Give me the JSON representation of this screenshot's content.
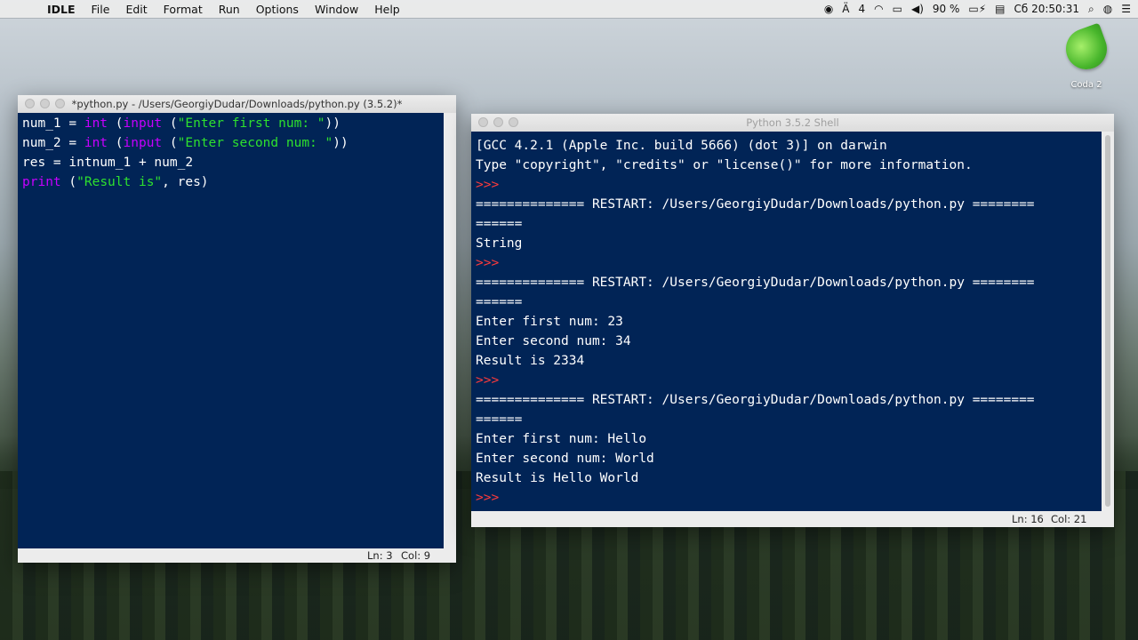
{
  "menubar": {
    "app_name": "IDLE",
    "items": [
      "File",
      "Edit",
      "Format",
      "Run",
      "Options",
      "Window",
      "Help"
    ],
    "status": {
      "input_indicator": "4",
      "battery": "90 %",
      "clock": "Сб 20:50:31"
    }
  },
  "desktop": {
    "coda_label": "Coda 2"
  },
  "editor_window": {
    "title": "*python.py - /Users/GeorgiyDudar/Downloads/python.py (3.5.2)*",
    "lines": [
      [
        {
          "t": "num_1 = ",
          "c": "plain"
        },
        {
          "t": "int",
          "c": "builtin"
        },
        {
          "t": " (",
          "c": "plain"
        },
        {
          "t": "input",
          "c": "builtin"
        },
        {
          "t": " (",
          "c": "plain"
        },
        {
          "t": "\"Enter first num: \"",
          "c": "str"
        },
        {
          "t": "))",
          "c": "plain"
        }
      ],
      [
        {
          "t": "num_2 = ",
          "c": "plain"
        },
        {
          "t": "int",
          "c": "builtin"
        },
        {
          "t": " (",
          "c": "plain"
        },
        {
          "t": "input",
          "c": "builtin"
        },
        {
          "t": " (",
          "c": "plain"
        },
        {
          "t": "\"Enter second num: \"",
          "c": "str"
        },
        {
          "t": "))",
          "c": "plain"
        }
      ],
      [
        {
          "t": "res = int",
          "c": "plain"
        },
        {
          "t": "num_1 + num_2",
          "c": "plain"
        }
      ],
      [
        {
          "t": "print",
          "c": "builtin"
        },
        {
          "t": " (",
          "c": "plain"
        },
        {
          "t": "\"Result is\"",
          "c": "str"
        },
        {
          "t": ", res)",
          "c": "plain"
        }
      ]
    ],
    "status": {
      "ln": "Ln: 3",
      "col": "Col: 9"
    }
  },
  "shell_window": {
    "title": "Python 3.5.2 Shell",
    "lines": [
      {
        "t": "[GCC 4.2.1 (Apple Inc. build 5666) (dot 3)] on darwin",
        "c": "plain"
      },
      {
        "t": "Type \"copyright\", \"credits\" or \"license()\" for more information.",
        "c": "plain"
      },
      {
        "t": ">>> ",
        "c": "prompt"
      },
      {
        "t": "============== RESTART: /Users/GeorgiyDudar/Downloads/python.py ========",
        "c": "plain"
      },
      {
        "t": "======",
        "c": "plain"
      },
      {
        "t": "String",
        "c": "plain"
      },
      {
        "t": ">>> ",
        "c": "prompt"
      },
      {
        "t": "============== RESTART: /Users/GeorgiyDudar/Downloads/python.py ========",
        "c": "plain"
      },
      {
        "t": "======",
        "c": "plain"
      },
      {
        "t": "Enter first num: 23",
        "c": "plain"
      },
      {
        "t": "Enter second num: 34",
        "c": "plain"
      },
      {
        "t": "Result is 2334",
        "c": "plain"
      },
      {
        "t": ">>> ",
        "c": "prompt"
      },
      {
        "t": "============== RESTART: /Users/GeorgiyDudar/Downloads/python.py ========",
        "c": "plain"
      },
      {
        "t": "======",
        "c": "plain"
      },
      {
        "t": "Enter first num: Hello",
        "c": "plain"
      },
      {
        "t": "Enter second num: World",
        "c": "plain"
      },
      {
        "t": "Result is Hello World",
        "c": "plain"
      },
      {
        "t": ">>> ",
        "c": "prompt"
      }
    ],
    "status": {
      "ln": "Ln: 16",
      "col": "Col: 21"
    }
  },
  "colors": {
    "editor_bg": "#012456",
    "builtin": "#c800ff",
    "string": "#2ee02e",
    "prompt": "#ff3b3b"
  }
}
